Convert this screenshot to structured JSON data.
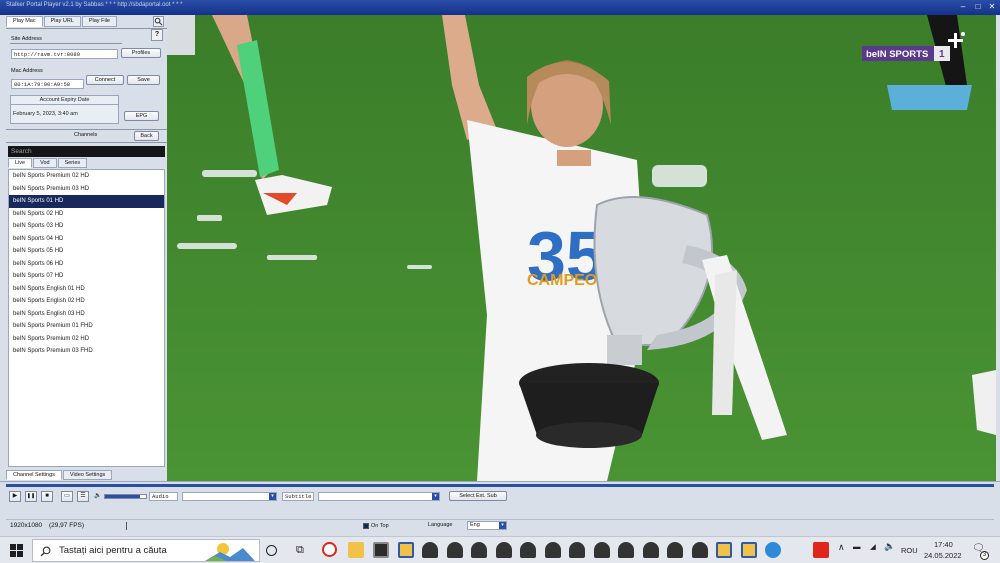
{
  "window": {
    "title": "Stalker Portal Player v2.1 by Sabbas * * * http://sbdaportal.oot * * *",
    "min": "–",
    "max": "□",
    "close": "✕"
  },
  "sidebar": {
    "tabs": [
      "Play Mac",
      "Play URL",
      "Play File"
    ],
    "help": "?",
    "portal_label": "Site Address",
    "portal_value": "http://ravm.tvr:8080",
    "profiles": "Profiles",
    "mac_label": "Mac Address",
    "mac_value": "00:1A:79:00:A9:58",
    "connect": "Connect",
    "save": "Save",
    "expiry_label": "Account Expiry Date",
    "expiry_value": "February 5, 2023, 3:40 am",
    "epg": "EPG",
    "channels_header": "Channels",
    "back": "Back",
    "search_placeholder": "Search",
    "subtabs": [
      "Live",
      "Vod",
      "Series"
    ],
    "channels": [
      "beIN Sports Premium 02 HD",
      "beIN Sports Premium 03 HD",
      "beIN Sports 01 HD",
      "beIN Sports 02 HD",
      "beIN Sports 03 HD",
      "beIN Sports 04 HD",
      "beIN Sports 05 HD",
      "beIN Sports 06 HD",
      "beIN Sports 07 HD",
      "beIN Sports English 01 HD",
      "beIN Sports English 02 HD",
      "beIN Sports English 03 HD",
      "beIN Sports Premium 01 FHD",
      "beIN Sports Premium 02 HD",
      "beIN Sports Premium 03 FHD"
    ],
    "selected_index": 2,
    "bottom_tabs": [
      "Channel Settings",
      "Video Settings"
    ]
  },
  "video": {
    "watermark_brand": "beIN SPORTS",
    "watermark_num": "1",
    "shirt_number": "35",
    "banner": "CAMPEONES"
  },
  "controls": {
    "play": "▶",
    "pause": "❚❚",
    "stop": "■",
    "screen": "▭",
    "playlist": "☰",
    "volume_icon": "🔈",
    "volume_level": 0.85,
    "audio_label": "Audio",
    "subtitle_label": "Subtitle",
    "select_ext_sub": "Select Ext. Sub",
    "resolution": "1920x1080",
    "fps": "(29,97 FPS)",
    "on_top": "On Top",
    "language_label": "Language",
    "language_value": "Eng"
  },
  "taskbar": {
    "search_text": "Tastați aici pentru a căuta",
    "time": "17:40",
    "date": "24.05.2022",
    "lang": "ROU",
    "notif_count": "3"
  },
  "colors": {
    "title_blue": "#14318a",
    "selection": "#16285c",
    "pitch_green": "#3f8a2e"
  }
}
